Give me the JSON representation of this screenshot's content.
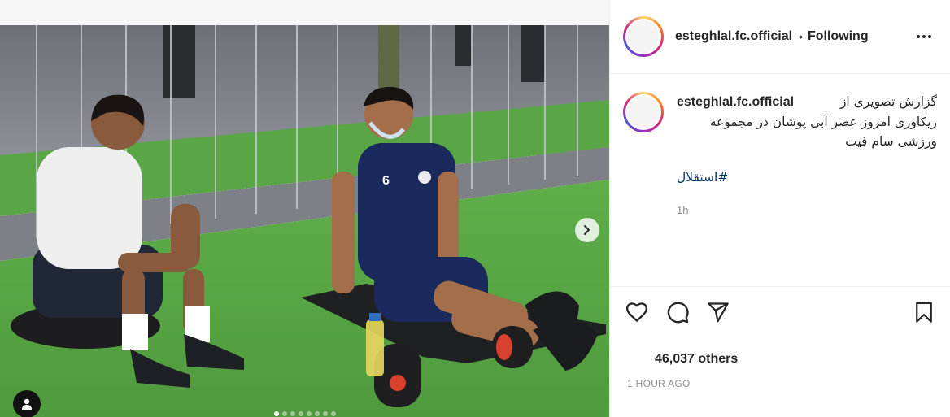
{
  "post": {
    "username": "esteghlal.fc.official",
    "separator": "•",
    "follow_status": "Following",
    "caption_line1": "گزارش تصویری از",
    "caption_rest": "ریکاوری امروز عصر آبی پوشان در مجموعه ورزشی سام فیت",
    "hashtag": "#استقلال",
    "caption_time": "1h",
    "likes_text": "46,037 others",
    "posted_ago": "1 HOUR AGO",
    "jersey_number": "6"
  },
  "carousel": {
    "slide_count": 8,
    "active_index": 0
  },
  "icons": {
    "more": "more-options-icon",
    "like": "heart-icon",
    "comment": "comment-icon",
    "share": "share-icon",
    "save": "bookmark-icon",
    "next": "chevron-right-icon",
    "tagged": "user-tag-icon"
  },
  "colors": {
    "text": "#262626",
    "secondary_text": "#8e8e8e",
    "hashtag": "#00376b",
    "divider": "#efefef",
    "turf": "#57a244",
    "jersey": "#1b2a5c"
  }
}
